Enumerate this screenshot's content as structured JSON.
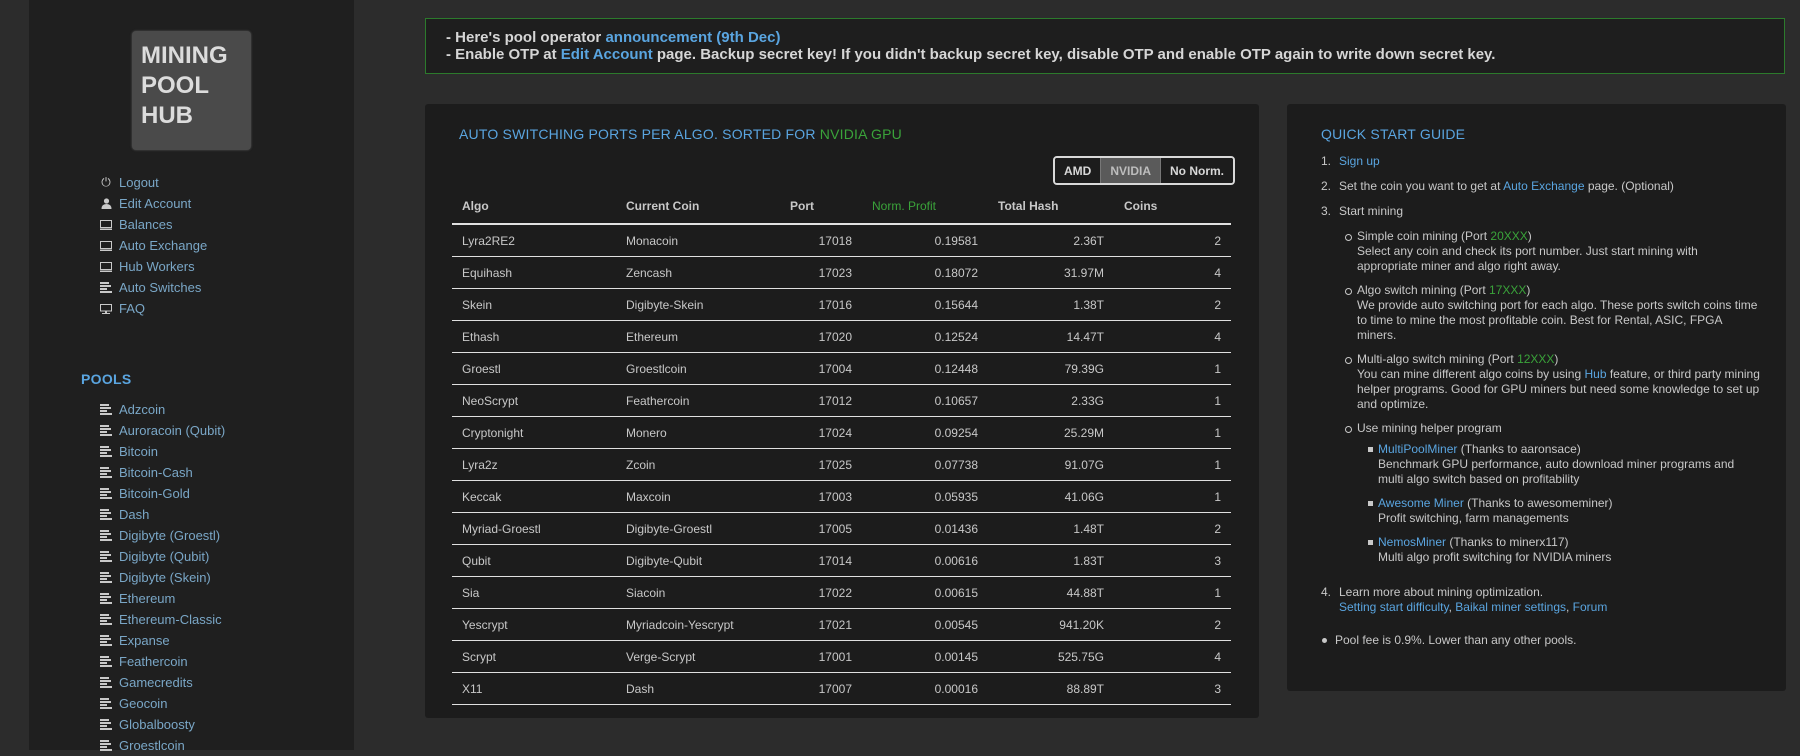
{
  "logo": {
    "lines": [
      "MINING",
      "POOL",
      "HUB"
    ]
  },
  "account_menu": [
    {
      "label": "Logout",
      "icon": "power-icon"
    },
    {
      "label": "Edit Account",
      "icon": "user-icon"
    },
    {
      "label": "Balances",
      "icon": "monitor-icon"
    },
    {
      "label": "Auto Exchange",
      "icon": "monitor-icon"
    },
    {
      "label": "Hub Workers",
      "icon": "monitor-icon"
    },
    {
      "label": "Auto Switches",
      "icon": "bars-icon"
    },
    {
      "label": "FAQ",
      "icon": "desktop-icon"
    }
  ],
  "pools": {
    "title": "POOLS",
    "items": [
      "Adzcoin",
      "Auroracoin (Qubit)",
      "Bitcoin",
      "Bitcoin-Cash",
      "Bitcoin-Gold",
      "Dash",
      "Digibyte (Groestl)",
      "Digibyte (Qubit)",
      "Digibyte (Skein)",
      "Ethereum",
      "Ethereum-Classic",
      "Expanse",
      "Feathercoin",
      "Gamecredits",
      "Geocoin",
      "Globalboosty",
      "Groestlcoin"
    ]
  },
  "announcement": {
    "line1_prefix": "- Here's pool operator ",
    "line1_link": "announcement (9th Dec)",
    "line2_prefix": "- Enable OTP at ",
    "line2_link": "Edit Account",
    "line2_suffix": " page. Backup secret key! If you didn't backup secret key, disable OTP and enable OTP again to write down secret key."
  },
  "ports": {
    "title_prefix": "AUTO SWITCHING PORTS PER ALGO. SORTED FOR ",
    "title_highlight": "NVIDIA GPU",
    "buttons": [
      {
        "label": "AMD",
        "active": false
      },
      {
        "label": "NVIDIA",
        "active": true
      },
      {
        "label": "No Norm.",
        "active": false
      }
    ],
    "columns": [
      "Algo",
      "Current Coin",
      "Port",
      "Norm. Profit",
      "Total Hash",
      "Coins"
    ],
    "rows": [
      [
        "Lyra2RE2",
        "Monacoin",
        "17018",
        "0.19581",
        "2.36T",
        "2"
      ],
      [
        "Equihash",
        "Zencash",
        "17023",
        "0.18072",
        "31.97M",
        "4"
      ],
      [
        "Skein",
        "Digibyte-Skein",
        "17016",
        "0.15644",
        "1.38T",
        "2"
      ],
      [
        "Ethash",
        "Ethereum",
        "17020",
        "0.12524",
        "14.47T",
        "4"
      ],
      [
        "Groestl",
        "Groestlcoin",
        "17004",
        "0.12448",
        "79.39G",
        "1"
      ],
      [
        "NeoScrypt",
        "Feathercoin",
        "17012",
        "0.10657",
        "2.33G",
        "1"
      ],
      [
        "Cryptonight",
        "Monero",
        "17024",
        "0.09254",
        "25.29M",
        "1"
      ],
      [
        "Lyra2z",
        "Zcoin",
        "17025",
        "0.07738",
        "91.07G",
        "1"
      ],
      [
        "Keccak",
        "Maxcoin",
        "17003",
        "0.05935",
        "41.06G",
        "1"
      ],
      [
        "Myriad-Groestl",
        "Digibyte-Groestl",
        "17005",
        "0.01436",
        "1.48T",
        "2"
      ],
      [
        "Qubit",
        "Digibyte-Qubit",
        "17014",
        "0.00616",
        "1.83T",
        "3"
      ],
      [
        "Sia",
        "Siacoin",
        "17022",
        "0.00615",
        "44.88T",
        "1"
      ],
      [
        "Yescrypt",
        "Myriadcoin-Yescrypt",
        "17021",
        "0.00545",
        "941.20K",
        "2"
      ],
      [
        "Scrypt",
        "Verge-Scrypt",
        "17001",
        "0.00145",
        "525.75G",
        "4"
      ],
      [
        "X11",
        "Dash",
        "17007",
        "0.00016",
        "88.89T",
        "3"
      ]
    ]
  },
  "guide": {
    "title": "QUICK START GUIDE",
    "step1_link": "Sign up",
    "step2_prefix": "Set the coin you want to get at ",
    "step2_link": "Auto Exchange",
    "step2_suffix": " page. (Optional)",
    "step3_label": "Start mining",
    "simple_prefix": "Simple coin mining (Port ",
    "simple_port": "20XXX",
    "simple_desc": "Select any coin and check its port number. Just start mining with appropriate miner and algo right away.",
    "algo_prefix": "Algo switch mining (Port ",
    "algo_port": "17XXX",
    "algo_desc": "We provide auto switching port for each algo. These ports switch coins time to time to mine the most profitable coin. Best for Rental, ASIC, FPGA miners.",
    "multi_prefix": "Multi-algo switch mining (Port ",
    "multi_port": "12XXX",
    "multi_desc_prefix": "You can mine different algo coins by using ",
    "multi_desc_link": "Hub",
    "multi_desc_suffix": " feature, or third party mining helper programs. Good for GPU miners but need some knowledge to set up and optimize.",
    "helper_label": "Use mining helper program",
    "helpers": [
      {
        "name": "MultiPoolMiner",
        "thanks": " (Thanks to aaronsace)",
        "desc": "Benchmark GPU performance, auto download miner programs and multi algo switch based on profitability"
      },
      {
        "name": "Awesome Miner",
        "thanks": " (Thanks to awesomeminer)",
        "desc": "Profit switching, farm managements"
      },
      {
        "name": "NemosMiner",
        "thanks": " (Thanks to minerx117)",
        "desc": "Multi algo profit switching for NVIDIA miners"
      }
    ],
    "step4_label": "Learn more about mining optimization.",
    "step4_links": [
      "Setting start difficulty",
      "Baikal miner settings",
      "Forum"
    ],
    "fee": "Pool fee is 0.9%. Lower than any other pools."
  }
}
